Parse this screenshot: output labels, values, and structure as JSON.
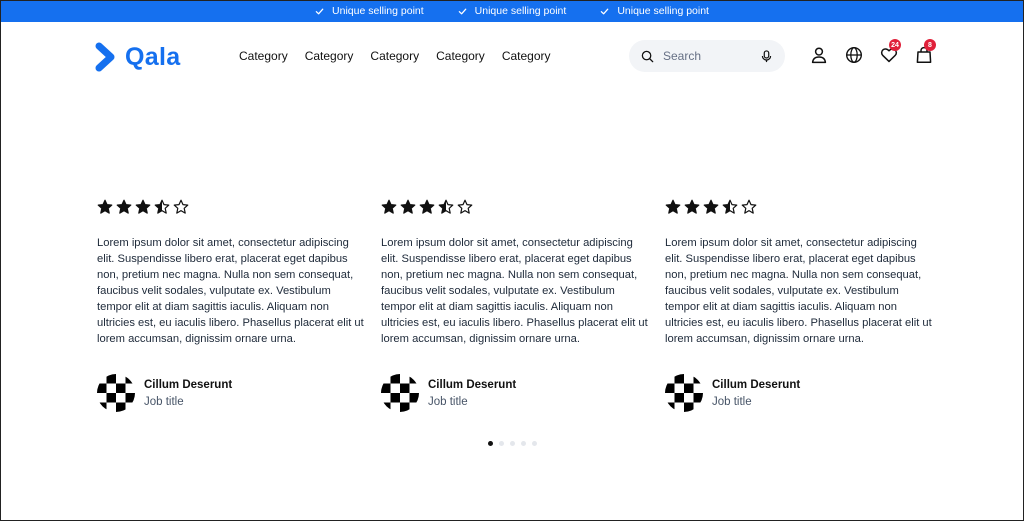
{
  "usp_bar": {
    "items": [
      "Unique selling point",
      "Unique selling point",
      "Unique selling point"
    ],
    "background_color": "#1570ef",
    "icon": "check-icon"
  },
  "header": {
    "logo_text": "Qala",
    "brand_color": "#1570ef",
    "nav": [
      "Category",
      "Category",
      "Category",
      "Category",
      "Category"
    ],
    "search": {
      "placeholder": "Search",
      "value": ""
    },
    "icons": [
      "user-icon",
      "globe-icon",
      "heart-icon",
      "bag-icon"
    ],
    "wishlist_count": "24",
    "cart_count": "8",
    "badge_color": "#e0203a"
  },
  "testimonials": [
    {
      "rating": 3.5,
      "text": "Lorem ipsum dolor sit amet, consectetur adipiscing elit. Suspendisse libero erat, placerat eget dapibus non, pretium nec magna. Nulla non sem consequat, faucibus velit sodales, vulputate ex. Vestibulum tempor elit at diam sagittis iaculis. Aliquam non ultricies est, eu iaculis libero. Phasellus placerat elit ut lorem accumsan, dignissim ornare urna.",
      "name": "Cillum Deserunt",
      "job_title": "Job title"
    },
    {
      "rating": 3.5,
      "text": "Lorem ipsum dolor sit amet, consectetur adipiscing elit. Suspendisse libero erat, placerat eget dapibus non, pretium nec magna. Nulla non sem consequat, faucibus velit sodales, vulputate ex. Vestibulum tempor elit at diam sagittis iaculis. Aliquam non ultricies est, eu iaculis libero. Phasellus placerat elit ut lorem accumsan, dignissim ornare urna.",
      "name": "Cillum Deserunt",
      "job_title": "Job title"
    },
    {
      "rating": 3.5,
      "text": "Lorem ipsum dolor sit amet, consectetur adipiscing elit. Suspendisse libero erat, placerat eget dapibus non, pretium nec magna. Nulla non sem consequat, faucibus velit sodales, vulputate ex. Vestibulum tempor elit at diam sagittis iaculis. Aliquam non ultricies est, eu iaculis libero. Phasellus placerat elit ut lorem accumsan, dignissim ornare urna.",
      "name": "Cillum Deserunt",
      "job_title": "Job title"
    }
  ],
  "carousel": {
    "total_slides": 5,
    "active_slide": 1
  }
}
